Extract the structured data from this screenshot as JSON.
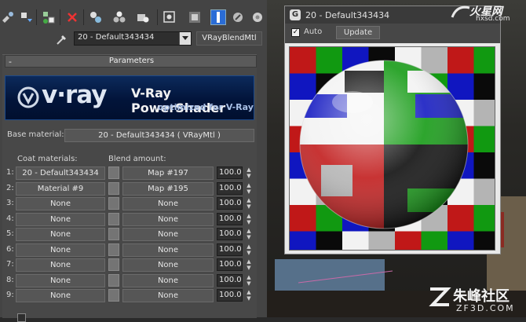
{
  "toolbar": {
    "icons": [
      "pick-icon",
      "put-scene-icon",
      "assign-icon",
      "reset-x-icon",
      "copy-icon",
      "unique-icon",
      "library-icon",
      "id-channel-icon",
      "show-map-icon",
      "show-end-icon",
      "go-parent-icon",
      "go-sibling-icon"
    ]
  },
  "material": {
    "name": "20 - Default343434",
    "type": "VRayBlendMtl"
  },
  "rollout": {
    "minus": "-",
    "title": "Parameters"
  },
  "banner": {
    "logo": "v·ray",
    "title": "V-Ray PowerShader",
    "subtitle": "optimized for V-Ray"
  },
  "base": {
    "label": "Base material:",
    "value": "20 - Default343434 ( VRayMtl )"
  },
  "headers": {
    "coat": "Coat materials:",
    "blend": "Blend amount:"
  },
  "rows": [
    {
      "num": "1:",
      "coat": "20 - Default343434",
      "blend": "Map #197",
      "amount": "100.0"
    },
    {
      "num": "2:",
      "coat": "Material #9",
      "blend": "Map #195",
      "amount": "100.0"
    },
    {
      "num": "3:",
      "coat": "None",
      "blend": "None",
      "amount": "100.0"
    },
    {
      "num": "4:",
      "coat": "None",
      "blend": "None",
      "amount": "100.0"
    },
    {
      "num": "5:",
      "coat": "None",
      "blend": "None",
      "amount": "100.0"
    },
    {
      "num": "6:",
      "coat": "None",
      "blend": "None",
      "amount": "100.0"
    },
    {
      "num": "7:",
      "coat": "None",
      "blend": "None",
      "amount": "100.0"
    },
    {
      "num": "8:",
      "coat": "None",
      "blend": "None",
      "amount": "100.0"
    },
    {
      "num": "9:",
      "coat": "None",
      "blend": "None",
      "amount": "100.0"
    }
  ],
  "preview": {
    "badge": "G",
    "title": "20 - Default343434",
    "auto_label": "Auto",
    "auto_checked": true,
    "update_label": "Update"
  },
  "watermark_top": {
    "main": "火星网",
    "url": "hxsd.com"
  },
  "watermark_bottom": {
    "main": "朱峰社区",
    "url": "ZF3D.COM"
  },
  "colors": {
    "red": "#c01818",
    "green": "#119911",
    "blue": "#1016c0",
    "black": "#0a0a0a",
    "white": "#f2f2f2",
    "gray": "#b4b4b4",
    "accent_blue": "#2a6cd6"
  }
}
